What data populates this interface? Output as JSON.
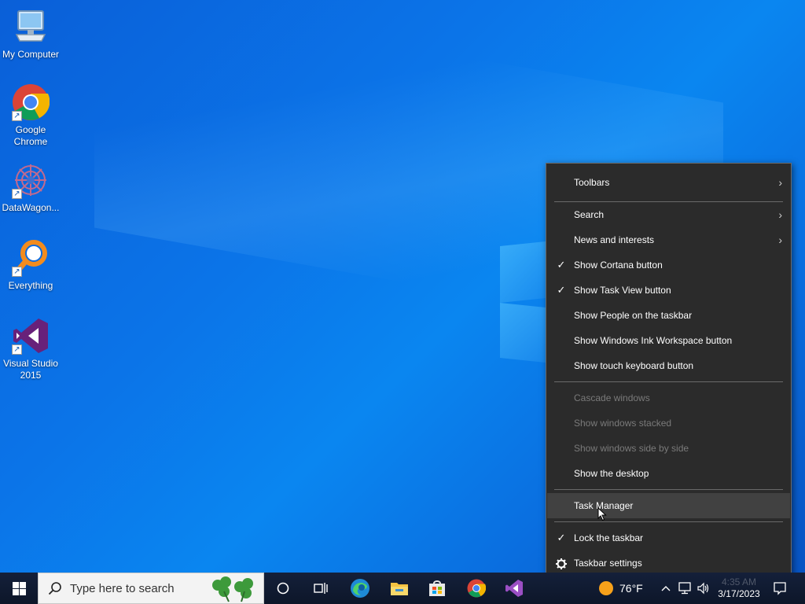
{
  "desktop": {
    "icons": [
      {
        "label": "My Computer",
        "icon": "computer-icon"
      },
      {
        "label": "Google Chrome",
        "icon": "chrome-icon"
      },
      {
        "label": "DataWagon...",
        "icon": "datawagon-icon"
      },
      {
        "label": "Everything",
        "icon": "everything-search-icon"
      },
      {
        "label": "Visual Studio 2015",
        "icon": "visual-studio-icon"
      }
    ]
  },
  "context_menu": {
    "items": [
      {
        "label": "Toolbars",
        "submenu": true
      },
      {
        "label": "Search",
        "submenu": true
      },
      {
        "label": "News and interests",
        "submenu": true
      },
      {
        "label": "Show Cortana button",
        "checked": true
      },
      {
        "label": "Show Task View button",
        "checked": true
      },
      {
        "label": "Show People on the taskbar"
      },
      {
        "label": "Show Windows Ink Workspace button"
      },
      {
        "label": "Show touch keyboard button"
      },
      {
        "label": "Cascade windows",
        "disabled": true
      },
      {
        "label": "Show windows stacked",
        "disabled": true
      },
      {
        "label": "Show windows side by side",
        "disabled": true
      },
      {
        "label": "Show the desktop"
      },
      {
        "label": "Task Manager",
        "highlighted": true
      },
      {
        "label": "Lock the taskbar",
        "checked": true
      },
      {
        "label": "Taskbar settings",
        "icon": "gear-icon"
      }
    ],
    "check_glyph": "✓",
    "arrow_glyph": "›"
  },
  "taskbar": {
    "search_placeholder": "Type here to search",
    "pinned": [
      "cortana-icon",
      "task-view-icon",
      "edge-icon",
      "file-explorer-icon",
      "store-icon",
      "chrome-icon",
      "visual-studio-icon"
    ],
    "weather": "76°F",
    "clock_time": "4:35 AM",
    "clock_date": "3/17/2023"
  },
  "colors": {
    "menu_bg": "#2b2b2b",
    "menu_highlight": "#414141",
    "menu_disabled": "#7a7a7a",
    "taskbar_bg": "#101a2e",
    "desktop_blue": "#0a74e8"
  }
}
